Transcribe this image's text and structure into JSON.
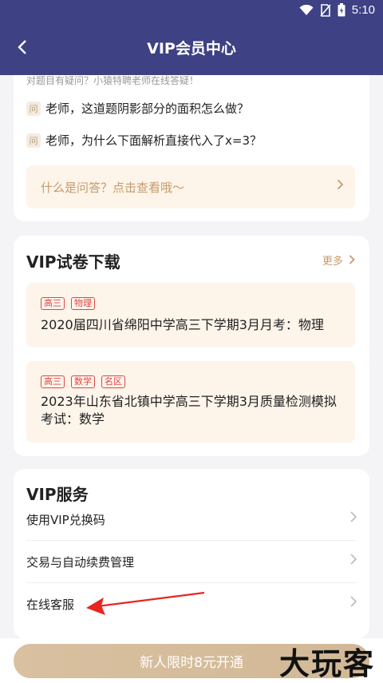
{
  "statusbar": {
    "time": "5:10"
  },
  "navbar": {
    "title": "VIP会员中心"
  },
  "qa": {
    "intro": "对题目有疑问？小猿特聘老师在线答疑！",
    "qicon": "问",
    "questions": [
      "老师，这道题阴影部分的面积怎么做？",
      "老师，为什么下面解析直接代入了x=3？"
    ],
    "link_text": "什么是问答？点击查看哦～"
  },
  "downloads": {
    "heading": "VIP试卷下载",
    "more_label": "更多",
    "items": [
      {
        "tags": [
          "高三",
          "物理"
        ],
        "title": "2020届四川省绵阳中学高三下学期3月月考：物理"
      },
      {
        "tags": [
          "高三",
          "数学",
          "名区"
        ],
        "title": "2023年山东省北镇中学高三下学期3月质量检测模拟考试：数学"
      }
    ]
  },
  "services": {
    "heading": "VIP服务",
    "rows": [
      "使用VIP兑换码",
      "交易与自动续费管理",
      "在线客服"
    ]
  },
  "footer": {
    "cta_label": "新人限时8元开通"
  },
  "watermark": "大玩客",
  "colors": {
    "nav_bg": "#3e4183",
    "accent": "#c79b6c",
    "tag_red": "#e0473e",
    "annotation_red": "#e8251f"
  }
}
